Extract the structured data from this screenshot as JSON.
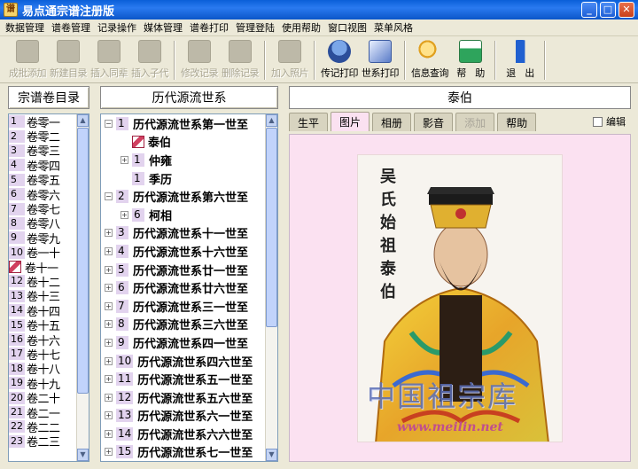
{
  "window": {
    "title": "易点通宗谱注册版",
    "app_icon": "谱",
    "controls": {
      "minimize": "_",
      "maximize": "□",
      "close": "✕"
    }
  },
  "menubar": [
    "数据管理",
    "谱卷管理",
    "记录操作",
    "媒体管理",
    "谱卷打印",
    "管理登陆",
    "使用帮助",
    "窗口视图",
    "菜单风格"
  ],
  "toolbar": {
    "group1": [
      {
        "label": "成批添加",
        "enabled": false,
        "icon": "batch-add-icon"
      },
      {
        "label": "新建目录",
        "enabled": false,
        "icon": "new-folder-icon"
      },
      {
        "label": "插入同辈",
        "enabled": false,
        "icon": "insert-sibling-icon"
      },
      {
        "label": "插入子代",
        "enabled": false,
        "icon": "insert-child-icon"
      }
    ],
    "group2": [
      {
        "label": "修改记录",
        "enabled": false,
        "icon": "edit-record-icon"
      },
      {
        "label": "删除记录",
        "enabled": false,
        "icon": "delete-record-icon"
      }
    ],
    "group3": [
      {
        "label": "加入照片",
        "enabled": false,
        "icon": "add-photo-icon"
      }
    ],
    "group4": [
      {
        "label": "传记打印",
        "enabled": true,
        "icon": "print-biography-icon"
      },
      {
        "label": "世系打印",
        "enabled": true,
        "icon": "print-lineage-icon"
      }
    ],
    "group5": [
      {
        "label": "信息查询",
        "enabled": true,
        "icon": "search-icon"
      },
      {
        "label": "帮　助",
        "enabled": true,
        "icon": "help-icon"
      }
    ],
    "group6": [
      {
        "label": "退　出",
        "enabled": true,
        "icon": "exit-icon"
      }
    ]
  },
  "left": {
    "header": "宗谱卷目录",
    "volumes": [
      {
        "n": "1",
        "label": "卷零一"
      },
      {
        "n": "2",
        "label": "卷零二"
      },
      {
        "n": "3",
        "label": "卷零三"
      },
      {
        "n": "4",
        "label": "卷零四"
      },
      {
        "n": "5",
        "label": "卷零五"
      },
      {
        "n": "6",
        "label": "卷零六"
      },
      {
        "n": "7",
        "label": "卷零七"
      },
      {
        "n": "8",
        "label": "卷零八"
      },
      {
        "n": "9",
        "label": "卷零九"
      },
      {
        "n": "10",
        "label": "卷一十"
      },
      {
        "n": "",
        "label": "卷十一",
        "pen": true
      },
      {
        "n": "12",
        "label": "卷十二"
      },
      {
        "n": "13",
        "label": "卷十三"
      },
      {
        "n": "14",
        "label": "卷十四"
      },
      {
        "n": "15",
        "label": "卷十五"
      },
      {
        "n": "16",
        "label": "卷十六"
      },
      {
        "n": "17",
        "label": "卷十七"
      },
      {
        "n": "18",
        "label": "卷十八"
      },
      {
        "n": "19",
        "label": "卷十九"
      },
      {
        "n": "20",
        "label": "卷二十"
      },
      {
        "n": "21",
        "label": "卷二一"
      },
      {
        "n": "22",
        "label": "卷二二"
      },
      {
        "n": "23",
        "label": "卷二三"
      }
    ]
  },
  "middle": {
    "header": "历代源流世系",
    "tree": [
      {
        "depth": 0,
        "expander": "−",
        "n": "1",
        "label": "历代源流世系第一世至"
      },
      {
        "depth": 1,
        "expander": "",
        "n": "",
        "label": "泰伯",
        "pen": true
      },
      {
        "depth": 1,
        "expander": "+",
        "n": "1",
        "label": "仲雍"
      },
      {
        "depth": 1,
        "expander": "",
        "n": "1",
        "label": "季历"
      },
      {
        "depth": 0,
        "expander": "−",
        "n": "2",
        "label": "历代源流世系第六世至"
      },
      {
        "depth": 1,
        "expander": "+",
        "n": "6",
        "label": "柯相"
      },
      {
        "depth": 0,
        "expander": "+",
        "n": "3",
        "label": "历代源流世系十一世至"
      },
      {
        "depth": 0,
        "expander": "+",
        "n": "4",
        "label": "历代源流世系十六世至"
      },
      {
        "depth": 0,
        "expander": "+",
        "n": "5",
        "label": "历代源流世系廿一世至"
      },
      {
        "depth": 0,
        "expander": "+",
        "n": "6",
        "label": "历代源流世系廿六世至"
      },
      {
        "depth": 0,
        "expander": "+",
        "n": "7",
        "label": "历代源流世系三一世至"
      },
      {
        "depth": 0,
        "expander": "+",
        "n": "8",
        "label": "历代源流世系三六世至"
      },
      {
        "depth": 0,
        "expander": "+",
        "n": "9",
        "label": "历代源流世系四一世至"
      },
      {
        "depth": 0,
        "expander": "+",
        "n": "10",
        "label": "历代源流世系四六世至"
      },
      {
        "depth": 0,
        "expander": "+",
        "n": "11",
        "label": "历代源流世系五一世至"
      },
      {
        "depth": 0,
        "expander": "+",
        "n": "12",
        "label": "历代源流世系五六世至"
      },
      {
        "depth": 0,
        "expander": "+",
        "n": "13",
        "label": "历代源流世系六一世至"
      },
      {
        "depth": 0,
        "expander": "+",
        "n": "14",
        "label": "历代源流世系六六世至"
      },
      {
        "depth": 0,
        "expander": "+",
        "n": "15",
        "label": "历代源流世系七一世至"
      }
    ]
  },
  "right": {
    "header": "泰伯",
    "tabs": [
      {
        "label": "生平",
        "active": false,
        "enabled": true
      },
      {
        "label": "图片",
        "active": true,
        "enabled": true
      },
      {
        "label": "相册",
        "active": false,
        "enabled": true
      },
      {
        "label": "影音",
        "active": false,
        "enabled": true
      },
      {
        "label": "添加",
        "active": false,
        "enabled": false
      },
      {
        "label": "帮助",
        "active": false,
        "enabled": true
      }
    ],
    "edit_label": "编辑",
    "portrait": {
      "caption": [
        "吴",
        "氏",
        "始",
        "祖",
        "泰",
        "伯"
      ],
      "watermark": "中国祖宗库",
      "url": "www.meilin.net"
    }
  },
  "colors": {
    "accent_pink": "#fbe1f1",
    "number_badge": "#e2d3ee",
    "titlebar": "#0a5fd8"
  }
}
